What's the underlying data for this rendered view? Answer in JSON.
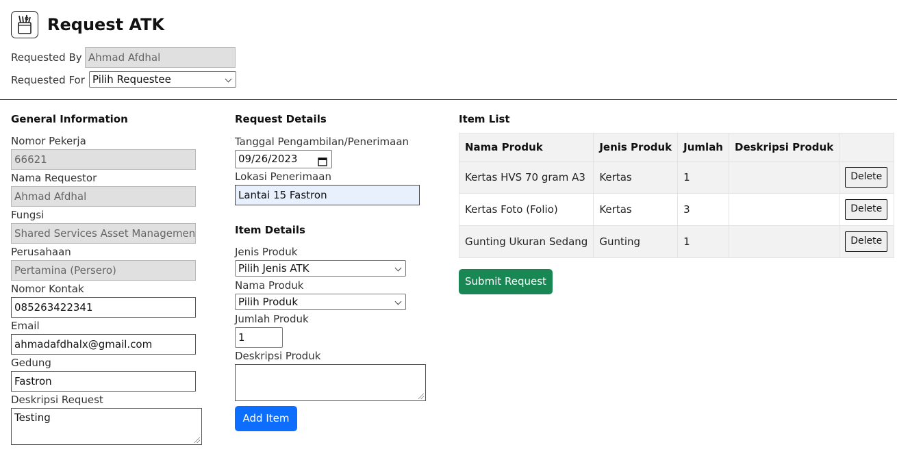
{
  "header": {
    "title": "Request ATK",
    "icon": "pencil-cup-icon",
    "requested_by_label": "Requested By :",
    "requested_by_value": "Ahmad Afdhal",
    "requested_for_label": "Requested For :",
    "requested_for_value": "Pilih Requestee"
  },
  "general": {
    "title": "General Information",
    "nomor_pekerja_label": "Nomor Pekerja",
    "nomor_pekerja_value": "66621",
    "nama_requestor_label": "Nama Requestor",
    "nama_requestor_value": "Ahmad Afdhal",
    "fungsi_label": "Fungsi",
    "fungsi_value": "Shared Services Asset Management",
    "perusahaan_label": "Perusahaan",
    "perusahaan_value": "Pertamina (Persero)",
    "nomor_kontak_label": "Nomor Kontak",
    "nomor_kontak_value": "085263422341",
    "email_label": "Email",
    "email_value": "ahmadafdhalx@gmail.com",
    "gedung_label": "Gedung",
    "gedung_value": "Fastron",
    "deskripsi_label": "Deskripsi Request",
    "deskripsi_value": "Testing"
  },
  "request_details": {
    "title": "Request Details",
    "tanggal_label": "Tanggal Pengambilan/Penerimaan",
    "tanggal_value": "09/26/2023",
    "lokasi_label": "Lokasi Penerimaan",
    "lokasi_value": "Lantai 15 Fastron"
  },
  "item_details": {
    "title": "Item Details",
    "jenis_label": "Jenis Produk",
    "jenis_value": "Pilih Jenis ATK",
    "nama_label": "Nama Produk",
    "nama_value": "Pilih Produk",
    "jumlah_label": "Jumlah Produk",
    "jumlah_value": "1",
    "deskripsi_label": "Deskripsi Produk",
    "deskripsi_value": "",
    "add_button": "Add Item"
  },
  "item_list": {
    "title": "Item List",
    "columns": [
      "Nama Produk",
      "Jenis Produk",
      "Jumlah",
      "Deskripsi Produk",
      ""
    ],
    "rows": [
      {
        "nama": "Kertas HVS 70 gram A3",
        "jenis": "Kertas",
        "jumlah": "1",
        "deskripsi": "",
        "action": "Delete"
      },
      {
        "nama": "Kertas Foto (Folio)",
        "jenis": "Kertas",
        "jumlah": "3",
        "deskripsi": "",
        "action": "Delete"
      },
      {
        "nama": "Gunting Ukuran Sedang",
        "jenis": "Gunting",
        "jumlah": "1",
        "deskripsi": "",
        "action": "Delete"
      }
    ],
    "submit_button": "Submit Request"
  },
  "colors": {
    "primary": "#0d6efd",
    "success": "#198754",
    "readonly_bg": "#e0e0e0",
    "focus_bg": "#e8f0fe"
  }
}
